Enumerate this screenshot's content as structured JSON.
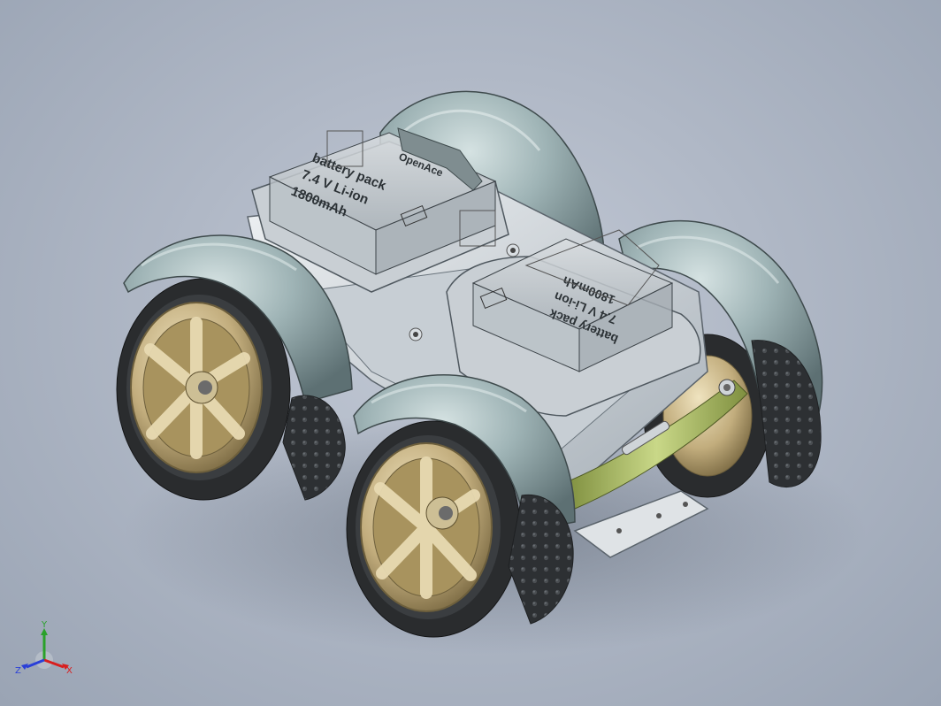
{
  "scene": {
    "description_free": true,
    "background_top": "#c3cad6",
    "background_bottom": "#9aa4b4"
  },
  "battery_front": {
    "line1": "battery pack",
    "line2": "7.4 V Li-ion",
    "line3": "1800mAh"
  },
  "battery_rear": {
    "line1": "battery pack",
    "line2": "7.4 V Li-ion",
    "line3": "1800mAh",
    "brand": "OpenAce"
  },
  "triad": {
    "x_label": "X",
    "y_label": "Y",
    "z_label": "Z",
    "x_color": "#d81e1e",
    "y_color": "#2aa12a",
    "z_color": "#2a3fd8"
  },
  "colors": {
    "fender": "#8fa4a6",
    "tire": "#2a2c2e",
    "rim": "#b8a478",
    "chassis": "#d3d8dc",
    "arm": "#a9b86a"
  }
}
